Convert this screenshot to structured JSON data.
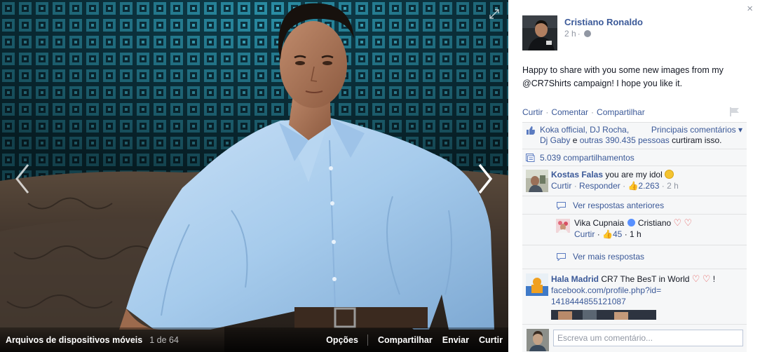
{
  "photo": {
    "album_name": "Arquivos de dispositivos móveis",
    "counter": "1 de 64",
    "actions": [
      "Opções",
      "Compartilhar",
      "Enviar",
      "Curtir"
    ]
  },
  "post": {
    "author": "Cristiano Ronaldo",
    "time": "2 h",
    "time_separator": "·",
    "text": "Happy to share with you some new images from my @CR7Shirts campaign! I hope you like it.",
    "close_glyph": "×"
  },
  "actions": {
    "like": "Curtir",
    "comment": "Comentar",
    "share": "Compartilhar",
    "dot": "·"
  },
  "likes": {
    "names_part1": "Koka official, DJ Rocha,",
    "names_part2": "Dj Gaby",
    "and": " e ",
    "others": "outras 390.435 pessoas",
    "suffix": " curtiram isso.",
    "top_comments": "Principais comentários ▾"
  },
  "shares": {
    "text": "5.039 compartilhamentos"
  },
  "comments": [
    {
      "name": "Kostas Falas",
      "text": " you are my idol ",
      "like_label": "Curtir",
      "reply_label": "Responder",
      "likes": "2.263",
      "time": "2 h"
    }
  ],
  "view_previous_replies": "Ver respostas anteriores",
  "reply": {
    "name": "Vika Cupnaia",
    "text": " Cristiano ",
    "like_label": "Curtir",
    "likes": "45",
    "time": "1 h"
  },
  "view_more_replies": "Ver mais respostas",
  "comment2": {
    "name": "Hala Madrid",
    "text": " CR7 The BesT in World ",
    "exclaim": " !",
    "link": "facebook.com/profile.php?id=1418444855121087"
  },
  "composer": {
    "placeholder": "Escreva um comentário..."
  },
  "colors": {
    "link": "#3b5998",
    "muted": "#9197a3",
    "panel": "#f6f7f8",
    "photo_wall": "#1f7d93",
    "shirt": "#a6cbec"
  }
}
